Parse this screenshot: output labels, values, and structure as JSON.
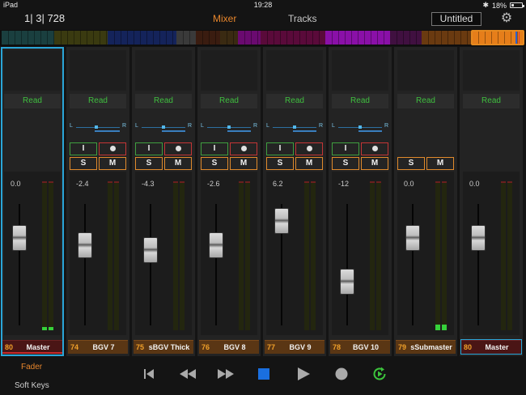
{
  "status_bar": {
    "device": "iPad",
    "time": "19:28",
    "battery": "18%"
  },
  "header": {
    "position": "1| 3| 728",
    "tabs": [
      {
        "label": "Mixer",
        "active": true
      },
      {
        "label": "Tracks",
        "active": false
      }
    ],
    "song_title": "Untitled",
    "settings_icon": "gear-icon"
  },
  "channels": [
    {
      "number": "80",
      "name": "Master",
      "volume": "0.0",
      "type": "master",
      "selected": true,
      "has_pan": false,
      "has_io": false,
      "has_sm": false,
      "fader_level": 0.72,
      "meter_level": 0.02,
      "bar_color": "#4a1515"
    },
    {
      "number": "74",
      "name": "BGV 7",
      "volume": "-2.4",
      "type": "track",
      "selected": false,
      "has_pan": true,
      "pan": 0.45,
      "has_io": true,
      "has_sm": true,
      "fader_level": 0.66,
      "meter_level": 0.0,
      "bar_color": "#5a3614"
    },
    {
      "number": "75",
      "name": "sBGV Thick",
      "volume": "-4.3",
      "type": "track",
      "selected": false,
      "has_pan": true,
      "pan": 0.5,
      "has_io": true,
      "has_sm": true,
      "fader_level": 0.62,
      "meter_level": 0.0,
      "bar_color": "#5a3614"
    },
    {
      "number": "76",
      "name": "BGV 8",
      "volume": "-2.6",
      "type": "track",
      "selected": false,
      "has_pan": true,
      "pan": 0.5,
      "has_io": true,
      "has_sm": true,
      "fader_level": 0.66,
      "meter_level": 0.0,
      "bar_color": "#5a3614"
    },
    {
      "number": "77",
      "name": "BGV 9",
      "volume": "6.2",
      "type": "track",
      "selected": false,
      "has_pan": true,
      "pan": 0.5,
      "has_io": true,
      "has_sm": true,
      "fader_level": 0.86,
      "meter_level": 0.0,
      "bar_color": "#5a3614"
    },
    {
      "number": "78",
      "name": "BGV 10",
      "volume": "-12",
      "type": "track",
      "selected": false,
      "has_pan": true,
      "pan": 0.5,
      "has_io": true,
      "has_sm": true,
      "fader_level": 0.36,
      "meter_level": 0.0,
      "bar_color": "#5a3614"
    },
    {
      "number": "79",
      "name": "sSubmaster",
      "volume": "0.0",
      "type": "track",
      "selected": false,
      "has_pan": false,
      "has_io": false,
      "has_sm": true,
      "fader_level": 0.72,
      "meter_level": 0.04,
      "bar_color": "#5a3614"
    },
    {
      "number": "80",
      "name": "Master",
      "volume": "0.0",
      "type": "master",
      "selected": false,
      "outlined": true,
      "has_pan": false,
      "has_io": false,
      "has_sm": false,
      "fader_level": 0.72,
      "meter_level": 0.0,
      "bar_color": "#4a1515"
    }
  ],
  "strip_labels": {
    "read": "Read",
    "input": "I",
    "solo": "S",
    "mute": "M",
    "pan_left": "L",
    "pan_right": "R"
  },
  "footer": {
    "fader_mode": "Fader",
    "softkeys_mode": "Soft Keys"
  },
  "transport": [
    {
      "name": "go-to-start-icon"
    },
    {
      "name": "rewind-icon"
    },
    {
      "name": "fast-forward-icon"
    },
    {
      "name": "stop-icon"
    },
    {
      "name": "play-icon"
    },
    {
      "name": "record-icon"
    },
    {
      "name": "loop-play-icon"
    }
  ],
  "colors": {
    "accent": "#e8862c",
    "read_green": "#3fbf3f",
    "selection_blue": "#2aa6d8",
    "stop_blue": "#1a6fe0",
    "loop_green": "#3cc43c"
  },
  "overview_segments": [
    {
      "color": "#1a3f3f",
      "width": 65
    },
    {
      "color": "#3a3a10",
      "width": 66
    },
    {
      "color": "#14235a",
      "width": 85
    },
    {
      "color": "#3a3a3a",
      "width": 24
    },
    {
      "color": "#3a1c10",
      "width": 30
    },
    {
      "color": "#3a2a12",
      "width": 22
    },
    {
      "color": "#6a0a70",
      "width": 28
    },
    {
      "color": "#5a0a3a",
      "width": 80
    },
    {
      "color": "#8a10a8",
      "width": 80
    },
    {
      "color": "#401040",
      "width": 39
    },
    {
      "color": "#6a3a10",
      "width": 62
    },
    {
      "color": "#e67e1a",
      "width": 64
    }
  ]
}
